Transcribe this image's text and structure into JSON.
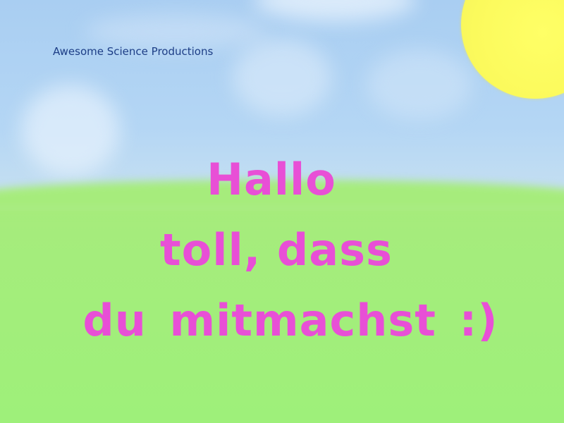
{
  "credit": "Awesome Science Productions",
  "greeting": {
    "line1": "Hallo",
    "line2": "toll, dass",
    "line3": "du mitmachst :)"
  },
  "colors": {
    "sky": "#b4d6f4",
    "grass": "#9ef07a",
    "sun": "#ffff66",
    "text": "#e84fd6",
    "credit": "#1d3e86"
  }
}
